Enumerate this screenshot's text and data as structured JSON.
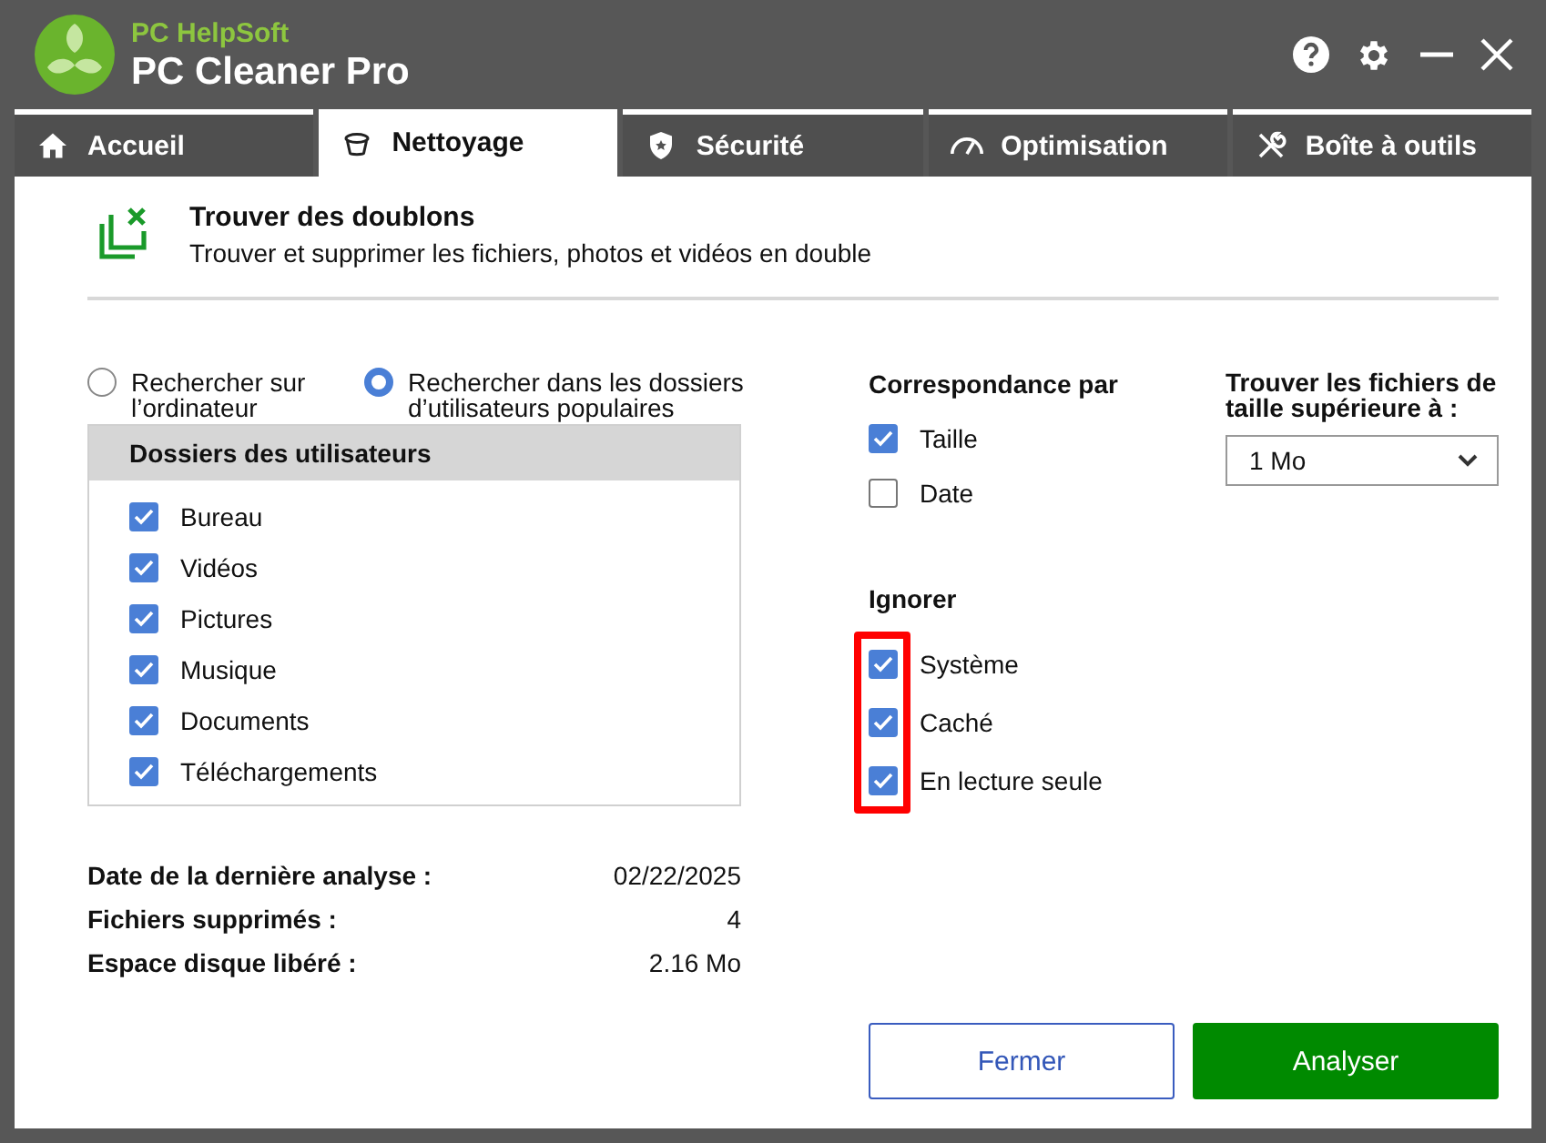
{
  "window": {
    "brand": "PC HelpSoft",
    "title": "PC Cleaner Pro"
  },
  "tabs": [
    {
      "label": "Accueil",
      "kind": "home",
      "selected": false
    },
    {
      "label": "Nettoyage",
      "kind": "clean",
      "selected": true
    },
    {
      "label": "Sécurité",
      "kind": "shield",
      "selected": false
    },
    {
      "label": "Optimisation",
      "kind": "gauge",
      "selected": false
    },
    {
      "label": "Boîte à outils",
      "kind": "tools",
      "selected": false
    }
  ],
  "header": {
    "title": "Trouver des doublons",
    "subtitle": "Trouver et supprimer les fichiers, photos et vidéos en double"
  },
  "search_scope": [
    {
      "label": "Rechercher sur l’ordinateur",
      "selected": false
    },
    {
      "label": "Rechercher dans les dossiers d’utilisateurs populaires",
      "selected": true
    }
  ],
  "folders": {
    "heading": "Dossiers des utilisateurs",
    "items": [
      {
        "label": "Bureau",
        "checked": true
      },
      {
        "label": "Vidéos",
        "checked": true
      },
      {
        "label": "Pictures",
        "checked": true
      },
      {
        "label": "Musique",
        "checked": true
      },
      {
        "label": "Documents",
        "checked": true
      },
      {
        "label": "Téléchargements",
        "checked": true
      }
    ]
  },
  "stats": [
    {
      "label": "Date de la dernière analyse :",
      "value": "02/22/2025"
    },
    {
      "label": "Fichiers supprimés :",
      "value": "4"
    },
    {
      "label": "Espace disque libéré :",
      "value": "2.16 Mo"
    }
  ],
  "match_by": {
    "heading": "Correspondance par",
    "items": [
      {
        "label": "Taille",
        "checked": true
      },
      {
        "label": "Date",
        "checked": false
      }
    ]
  },
  "ignore": {
    "heading": "Ignorer",
    "highlighted": true,
    "items": [
      {
        "label": "Système",
        "checked": true
      },
      {
        "label": "Caché",
        "checked": true
      },
      {
        "label": "En lecture seule",
        "checked": true
      }
    ]
  },
  "size_filter": {
    "label": "Trouver les fichiers de taille supérieure à :",
    "value": "1 Mo"
  },
  "buttons": [
    {
      "label": "Fermer",
      "kind": "secondary"
    },
    {
      "label": "Analyser",
      "kind": "primary"
    }
  ]
}
